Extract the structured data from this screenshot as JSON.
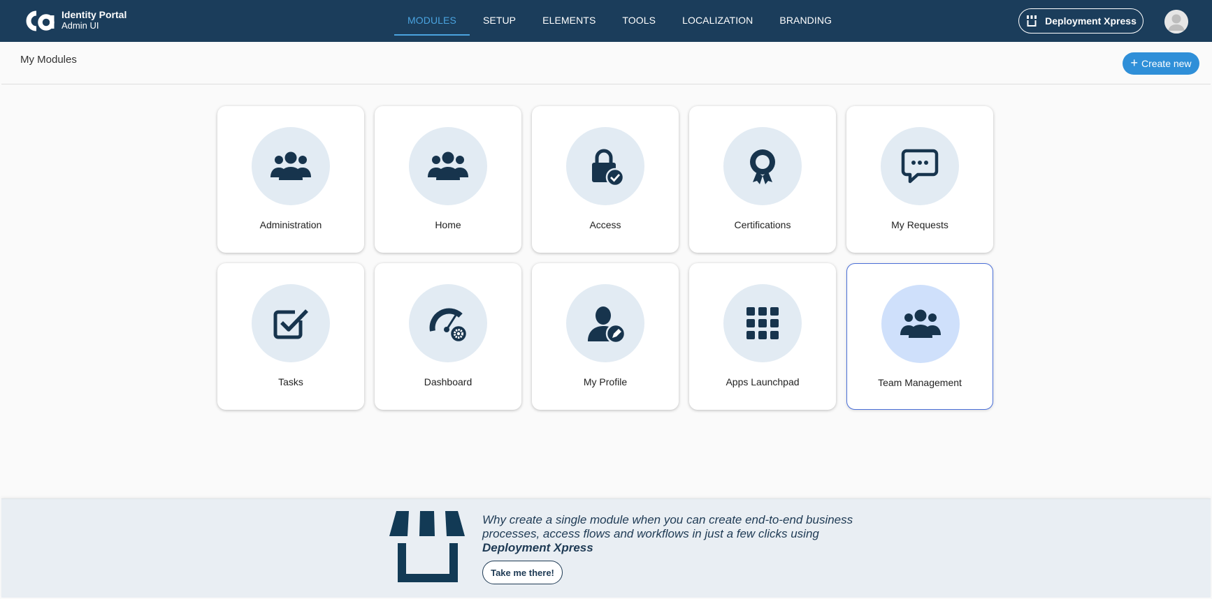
{
  "app": {
    "name": "Identity Portal",
    "subtitle": "Admin UI"
  },
  "nav": {
    "items": [
      {
        "label": "MODULES",
        "active": true
      },
      {
        "label": "SETUP"
      },
      {
        "label": "ELEMENTS"
      },
      {
        "label": "TOOLS"
      },
      {
        "label": "LOCALIZATION"
      },
      {
        "label": "BRANDING"
      }
    ],
    "deployment_button": "Deployment Xpress"
  },
  "header": {
    "title": "My Modules",
    "create_label": "Create new"
  },
  "modules": [
    {
      "label": "Administration",
      "icon": "users-group-icon"
    },
    {
      "label": "Home",
      "icon": "users-group-icon"
    },
    {
      "label": "Access",
      "icon": "lock-check-icon"
    },
    {
      "label": "Certifications",
      "icon": "award-ribbon-icon"
    },
    {
      "label": "My Requests",
      "icon": "chat-bubble-icon"
    },
    {
      "label": "Tasks",
      "icon": "checkbox-icon"
    },
    {
      "label": "Dashboard",
      "icon": "gauge-gear-icon"
    },
    {
      "label": "My Profile",
      "icon": "user-edit-icon"
    },
    {
      "label": "Apps Launchpad",
      "icon": "grid-apps-icon"
    },
    {
      "label": "Team Management",
      "icon": "users-group-icon",
      "selected": true
    }
  ],
  "promo": {
    "text": "Why create a single module when you can create end-to-end business processes, access flows and workflows in just a few clicks using",
    "highlight": "Deployment Xpress",
    "button": "Take me there!"
  },
  "colors": {
    "topbar": "#1b3d5b",
    "accent": "#4aa3df",
    "primary_button": "#2f8fd8",
    "icon": "#17344d",
    "icon_circle": "#e2ebf3",
    "selected_circle": "#cfe0fb",
    "selected_border": "#4a6fd8"
  }
}
